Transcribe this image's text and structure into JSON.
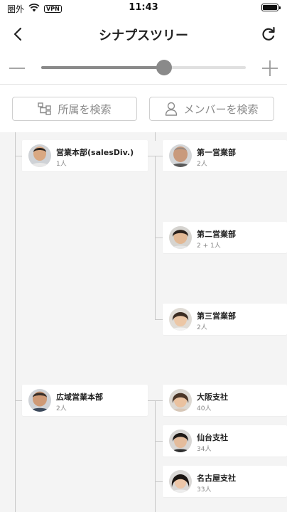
{
  "status_bar": {
    "carrier": "圏外",
    "vpn": "VPN",
    "time": "11:43"
  },
  "nav": {
    "title": "シナプスツリー"
  },
  "zoom": {
    "level": 0.6
  },
  "search": {
    "affiliation_label": "所属を検索",
    "member_label": "メンバーを検索"
  },
  "tree": {
    "divisions": [
      {
        "name": "営業本部(salesDiv.)",
        "count": "1人"
      },
      {
        "name": "広域営業本部",
        "count": "2人"
      }
    ],
    "departments": [
      {
        "name": "第一営業部",
        "count": "2人"
      },
      {
        "name": "第二営業部",
        "count": "2 + 1人"
      },
      {
        "name": "第三営業部",
        "count": "2人"
      },
      {
        "name": "大阪支社",
        "count": "40人"
      },
      {
        "name": "仙台支社",
        "count": "34人"
      },
      {
        "name": "名古屋支社",
        "count": "33人"
      }
    ]
  }
}
